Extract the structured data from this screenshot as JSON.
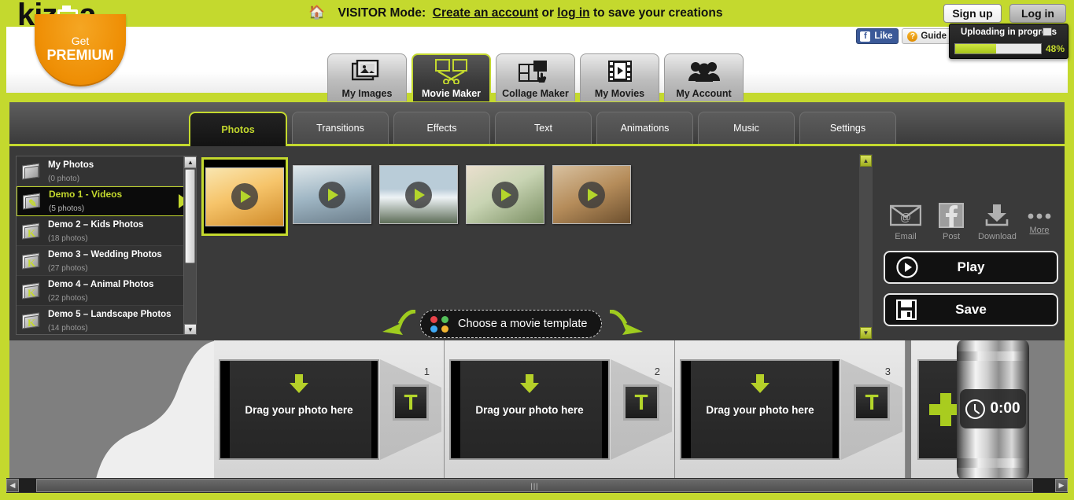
{
  "brand": {
    "name": "kizoa",
    "accent": "#c4d92e",
    "premium_get": "Get",
    "premium_label": "PREMIUM"
  },
  "topbar": {
    "home_icon": "home-icon",
    "mode_prefix": "VISITOR Mode:",
    "create_account": "Create an account",
    "or": "or",
    "log_in": "log in",
    "suffix": "to save your creations",
    "signup_label": "Sign up",
    "login_label": "Log in"
  },
  "minibar": {
    "like_label": "Like",
    "like_f": "f",
    "guide_label": "Guide",
    "guide_q": "?",
    "phone_icon": "phone-icon",
    "mail_icon": "mail-icon",
    "visitor_mode_label": "VISITOR Mode"
  },
  "upload_tooltip": {
    "title": "Uploading in progress",
    "percent_label": "48%",
    "percent": 48,
    "fill_color": "#b5d029"
  },
  "main_tabs": [
    {
      "label": "My Images",
      "icon": "images-stack-icon",
      "active": false
    },
    {
      "label": "Movie Maker",
      "icon": "film-scissors-icon",
      "active": true
    },
    {
      "label": "Collage Maker",
      "icon": "collage-hand-icon",
      "active": false
    },
    {
      "label": "My Movies",
      "icon": "film-play-icon",
      "active": false
    },
    {
      "label": "My Account",
      "icon": "people-icon",
      "active": false
    }
  ],
  "sub_tabs": [
    {
      "label": "Photos",
      "active": true
    },
    {
      "label": "Transitions",
      "active": false
    },
    {
      "label": "Effects",
      "active": false
    },
    {
      "label": "Text",
      "active": false
    },
    {
      "label": "Animations",
      "active": false
    },
    {
      "label": "Music",
      "active": false
    },
    {
      "label": "Settings",
      "active": false
    }
  ],
  "albums": [
    {
      "name": "My Photos",
      "count": "(0 photo)",
      "selected": false,
      "icon": "book-icon"
    },
    {
      "name": "Demo 1 - Videos",
      "count": "(5 photos)",
      "selected": true,
      "icon": "open-book-icon"
    },
    {
      "name": "Demo 2 – Kids Photos",
      "count": "(18 photos)",
      "selected": false,
      "icon": "k-book-icon"
    },
    {
      "name": "Demo 3 – Wedding Photos",
      "count": "(27 photos)",
      "selected": false,
      "icon": "k-book-icon"
    },
    {
      "name": "Demo 4 – Animal Photos",
      "count": "(22 photos)",
      "selected": false,
      "icon": "k-book-icon"
    },
    {
      "name": "Demo 5 – Landscape Photos",
      "count": "(14 photos)",
      "selected": false,
      "icon": "k-book-icon"
    }
  ],
  "thumbnails": [
    {
      "alt": "sunset-field-video",
      "selected": true,
      "c1": "#f6c46a",
      "c2": "#d08b2a",
      "c3": "#f9e6b0"
    },
    {
      "alt": "couple-bridge-video",
      "selected": false,
      "c1": "#9fb6c4",
      "c2": "#6d7f8c",
      "c3": "#dfe7ea"
    },
    {
      "alt": "snow-mountain-video",
      "selected": false,
      "c1": "#b9ccd8",
      "c2": "#5e6e58",
      "c3": "#eef3f6"
    },
    {
      "alt": "waterfall-video",
      "selected": false,
      "c1": "#c8d4b3",
      "c2": "#7b8f63",
      "c3": "#eadfce"
    },
    {
      "alt": "autumn-leaves-video",
      "selected": false,
      "c1": "#b58c5a",
      "c2": "#6c4f2e",
      "c3": "#d8c1a0"
    }
  ],
  "share_actions": [
    {
      "label": "Email",
      "icon": "email-icon"
    },
    {
      "label": "Post",
      "icon": "facebook-icon"
    },
    {
      "label": "Download",
      "icon": "download-icon"
    },
    {
      "label": "More",
      "icon": "more-dots-icon"
    }
  ],
  "buttons": {
    "play_label": "Play",
    "save_label": "Save"
  },
  "choose_template": {
    "label": "Choose a movie template",
    "dot_colors": [
      "#e8434a",
      "#54c05a",
      "#3fa9f5",
      "#f2b632"
    ]
  },
  "timeline": {
    "drop_text": "Drag your photo here",
    "text_button": "T",
    "slots": [
      {
        "number": "1"
      },
      {
        "number": "2"
      },
      {
        "number": "3"
      }
    ],
    "add_icon": "plus-icon",
    "duration": "0:00",
    "clock_icon": "clock-icon"
  },
  "scrollbars": {
    "up_arrow": "▲",
    "down_arrow": "▼",
    "left_arrow": "◀",
    "right_arrow": "▶",
    "grip": "|||"
  }
}
